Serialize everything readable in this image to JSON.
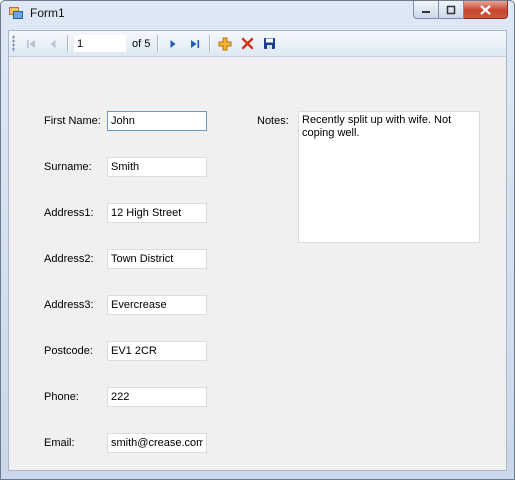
{
  "window": {
    "title": "Form1"
  },
  "toolbar": {
    "position_value": "1",
    "of_text": "of 5",
    "icons": [
      "move-first",
      "move-previous",
      "move-next",
      "move-last",
      "add-new",
      "delete",
      "save"
    ]
  },
  "form": {
    "first_name": {
      "label": "First Name:",
      "value": "John"
    },
    "surname": {
      "label": "Surname:",
      "value": "Smith"
    },
    "address1": {
      "label": "Address1:",
      "value": "12 High Street"
    },
    "address2": {
      "label": "Address2:",
      "value": "Town District"
    },
    "address3": {
      "label": "Address3:",
      "value": "Evercrease"
    },
    "postcode": {
      "label": "Postcode:",
      "value": "EV1 2CR"
    },
    "phone": {
      "label": "Phone:",
      "value": "222"
    },
    "email": {
      "label": "Email:",
      "value": "smith@crease.com"
    },
    "notes": {
      "label": "Notes:",
      "value": "Recently split up with wife. Not coping well."
    }
  },
  "colors": {
    "nav_blue": "#1e5fb4",
    "add_orange": "#e8a020",
    "delete_red": "#d2321e",
    "save_blue": "#1a3f8f"
  }
}
